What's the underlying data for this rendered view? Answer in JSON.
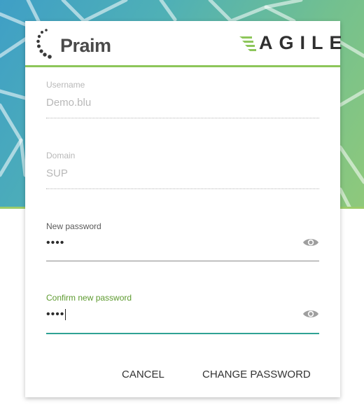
{
  "header": {
    "left_logo_text": "Praim",
    "right_logo_text": "AGILE"
  },
  "form": {
    "username": {
      "label": "Username",
      "value": "Demo.blu"
    },
    "domain": {
      "label": "Domain",
      "value": "SUP"
    },
    "new_password": {
      "label": "New password",
      "value": "••••"
    },
    "confirm_password": {
      "label": "Confirm new password",
      "value": "••••"
    }
  },
  "actions": {
    "cancel_label": "CANCEL",
    "change_password_label": "CHANGE PASSWORD"
  },
  "colors": {
    "accent_green": "#8dc65a",
    "focus_label": "#5d9a2f",
    "focus_underline": "#2fa294"
  },
  "icons": {
    "show_password": "eye-icon"
  }
}
